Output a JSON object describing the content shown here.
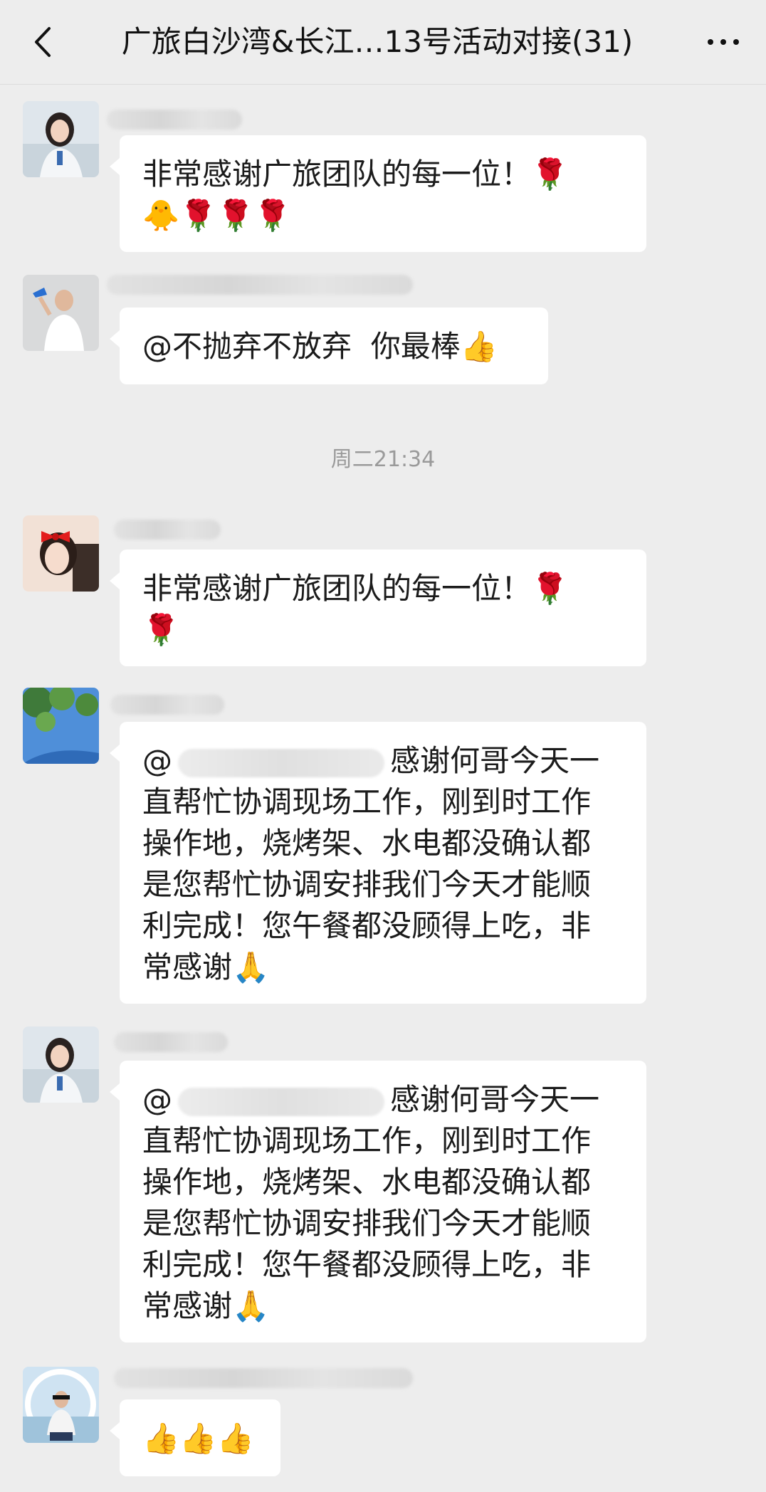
{
  "header": {
    "title": "广旅白沙湾&长江…13号活动对接(31)",
    "back_icon": "chevron-left-icon",
    "more_icon": "more-dots-icon"
  },
  "divider_time": "周二21:34",
  "messages": [
    {
      "mention": "",
      "text": "非常感谢广旅团队的每一位！🌹\n🐥🌹🌹🌹"
    },
    {
      "mention": "",
      "text": "@不抛弃不放弃  你最棒👍"
    },
    {
      "mention": "",
      "text": "非常感谢广旅团队的每一位！🌹\n🌹"
    },
    {
      "mention": "@",
      "text": "感谢何哥今天一\n直帮忙协调现场工作，刚到时工作\n操作地，烧烤架、水电都没确认都\n是您帮忙协调安排我们今天才能顺\n利完成！您午餐都没顾得上吃，非\n常感谢🙏"
    },
    {
      "mention": "@",
      "text": "感谢何哥今天一\n直帮忙协调现场工作，刚到时工作\n操作地，烧烤架、水电都没确认都\n是您帮忙协调安排我们今天才能顺\n利完成！您午餐都没顾得上吃，非\n常感谢🙏"
    },
    {
      "mention": "",
      "text": "👍👍👍"
    }
  ]
}
